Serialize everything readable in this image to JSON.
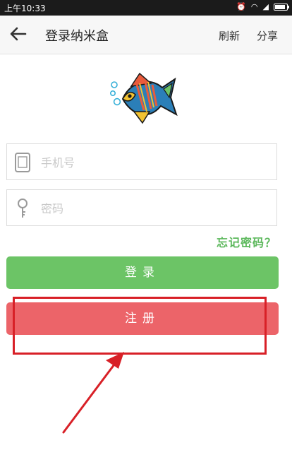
{
  "status_bar": {
    "time": "上午10:33",
    "icons": [
      "alarm-icon",
      "wifi-icon",
      "signal-icon",
      "battery-icon"
    ]
  },
  "header": {
    "title": "登录纳米盒",
    "refresh_label": "刷新",
    "share_label": "分享"
  },
  "form": {
    "phone_placeholder": "手机号",
    "password_placeholder": "密码",
    "forgot_label": "忘记密码？",
    "login_label": "登录",
    "register_label": "注册"
  },
  "colors": {
    "login_button": "#6cc466",
    "register_button": "#ec6469",
    "forgot_link": "#5cb85c",
    "annotation": "#d82027"
  }
}
